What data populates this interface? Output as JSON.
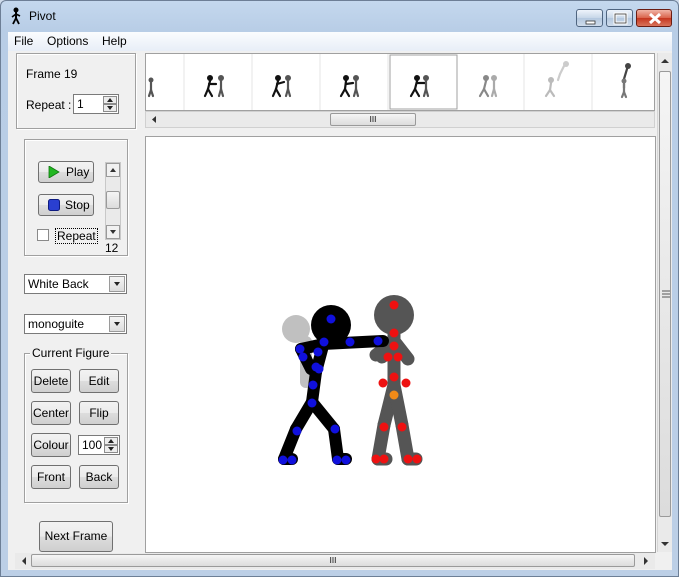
{
  "window": {
    "title": "Pivot",
    "accent": "#c4d8ee"
  },
  "menu": {
    "items": [
      "File",
      "Options",
      "Help"
    ]
  },
  "frame_info": {
    "frame_label": "Frame 19",
    "repeat_label": "Repeat :",
    "repeat_value": "1"
  },
  "playback": {
    "play_label": "Play",
    "stop_label": "Stop",
    "repeat_checkbox_label": "Repeat",
    "repeat_checked": false,
    "speed_value": "12",
    "play_icon_color": "#22b722",
    "stop_icon_color": "#2a3fd0"
  },
  "background_select": {
    "value": "White Back"
  },
  "figure_select": {
    "value": "monoguite"
  },
  "current_figure": {
    "group_label": "Current Figure",
    "delete_label": "Delete",
    "edit_label": "Edit",
    "center_label": "Center",
    "flip_label": "Flip",
    "colour_label": "Colour",
    "colour_value": "100",
    "front_label": "Front",
    "back_label": "Back"
  },
  "next_frame_label": "Next Frame",
  "figures": {
    "black_figure_color": "#000000",
    "black_joint_color": "#1010dd",
    "grey_figure_color": "#555555",
    "grey_joint_color": "#ee1111",
    "grey_origin_color": "#f08a18",
    "ghost_color": "#c0c0c0"
  },
  "scroll_grip": "III"
}
